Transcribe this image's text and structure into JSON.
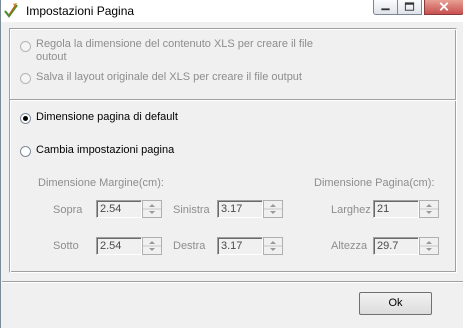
{
  "window": {
    "title": "Impostazioni Pagina",
    "app_icon": "pencil-check-icon"
  },
  "title_buttons": {
    "minimize_icon": "minimize-icon",
    "maximize_icon": "maximize-icon",
    "close_icon": "close-icon"
  },
  "options": {
    "resize": {
      "label_line1": "Regola la dimensione del contenuto XLS per creare il file",
      "label_line2": "outout",
      "selected": false,
      "enabled": false
    },
    "keep_layout": {
      "label": "Salva il layout originale del XLS per creare il file output",
      "selected": false,
      "enabled": false
    },
    "default_size": {
      "label": "Dimensione pagina di default",
      "selected": true,
      "enabled": true
    },
    "change_settings": {
      "label": "Cambia impostazioni pagina",
      "selected": false,
      "enabled": true
    }
  },
  "margins": {
    "heading": "Dimensione Margine(cm):",
    "top": {
      "label": "Sopra",
      "value": "2.54"
    },
    "bottom": {
      "label": "Sotto",
      "value": "2.54"
    },
    "left": {
      "label": "Sinistra",
      "value": "3.17"
    },
    "right": {
      "label": "Destra",
      "value": "3.17"
    }
  },
  "page_size": {
    "heading": "Dimensione Pagina(cm):",
    "width": {
      "label": "Larghez",
      "value": "21"
    },
    "height": {
      "label": "Altezza",
      "value": "29.7"
    }
  },
  "ok_label": "Ok"
}
